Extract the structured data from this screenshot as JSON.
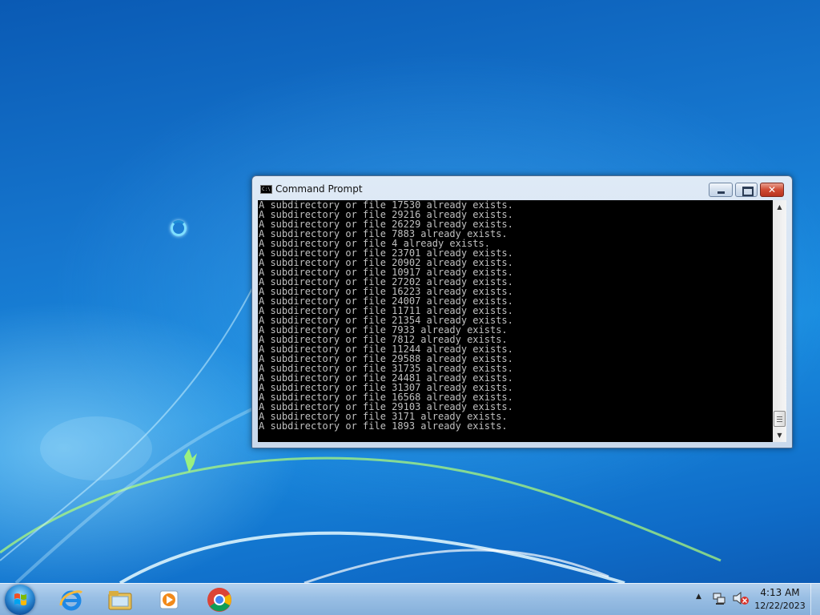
{
  "window": {
    "title": "Command Prompt",
    "close_glyph": "✕",
    "icon_text": "C:\\",
    "output_lines": [
      "A subdirectory or file 17530 already exists.",
      "A subdirectory or file 29216 already exists.",
      "A subdirectory or file 26229 already exists.",
      "A subdirectory or file 7883 already exists.",
      "A subdirectory or file 4 already exists.",
      "A subdirectory or file 23701 already exists.",
      "A subdirectory or file 20902 already exists.",
      "A subdirectory or file 10917 already exists.",
      "A subdirectory or file 27202 already exists.",
      "A subdirectory or file 16223 already exists.",
      "A subdirectory or file 24007 already exists.",
      "A subdirectory or file 11711 already exists.",
      "A subdirectory or file 21354 already exists.",
      "A subdirectory or file 7933 already exists.",
      "A subdirectory or file 7812 already exists.",
      "A subdirectory or file 11244 already exists.",
      "A subdirectory or file 29588 already exists.",
      "A subdirectory or file 31735 already exists.",
      "A subdirectory or file 24481 already exists.",
      "A subdirectory or file 31307 already exists.",
      "A subdirectory or file 16568 already exists.",
      "A subdirectory or file 29103 already exists.",
      "A subdirectory or file 3171 already exists.",
      "A subdirectory or file 1893 already exists."
    ],
    "console_bg": "#000000",
    "console_fg": "#c0c0c0",
    "scroll_up_glyph": "▲",
    "scroll_down_glyph": "▼"
  },
  "taskbar": {
    "pinned": [
      {
        "name": "internet-explorer-icon"
      },
      {
        "name": "windows-explorer-icon"
      },
      {
        "name": "media-player-icon"
      },
      {
        "name": "chrome-icon"
      }
    ],
    "tray_chevron": "▲",
    "clock_time": "4:13 AM",
    "clock_date": "12/22/2023"
  },
  "colors": {
    "desktop": "#1677cf",
    "close_button": "#cf4b33"
  }
}
